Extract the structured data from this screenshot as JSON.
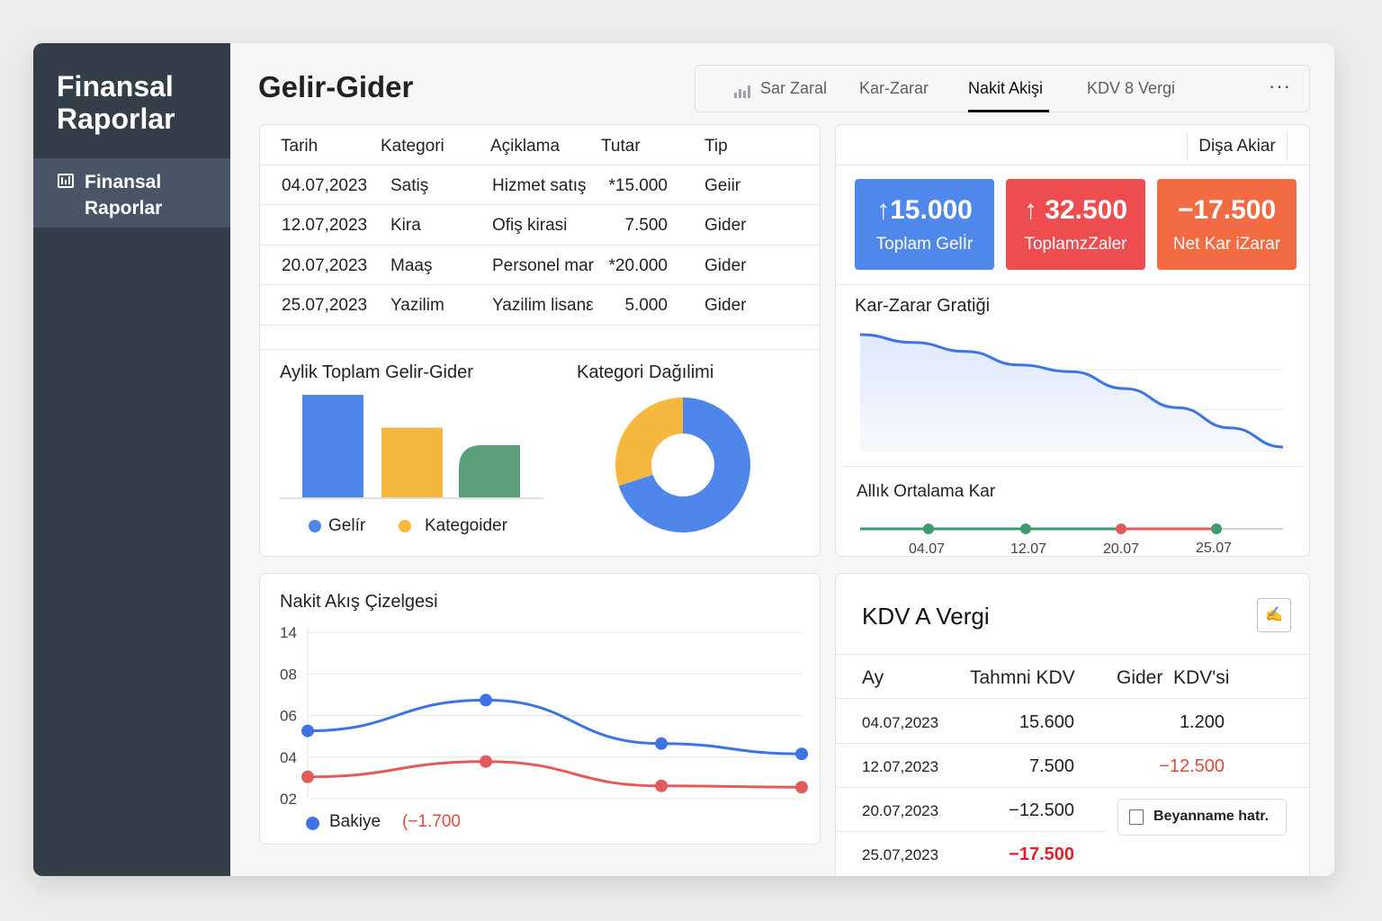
{
  "sidebar": {
    "brand_line1": "Finansal",
    "brand_line2": "Raporlar",
    "items": [
      {
        "label_line1": "Finansal",
        "label_line2": "Raporlar",
        "icon": "bar-chart-icon"
      }
    ]
  },
  "header": {
    "title": "Gelir-Gider",
    "tabs": [
      {
        "label": "Sar Zaral",
        "icon": "bar-chart-icon",
        "active": false
      },
      {
        "label": "Kar-Zarar",
        "active": false
      },
      {
        "label": "Nakit Akişi",
        "active": true
      },
      {
        "label": "KDV 8 Vergi",
        "active": false
      }
    ],
    "more": "···"
  },
  "transactions": {
    "headers": [
      "Tarih",
      "Kategori",
      "Açiklama",
      "Tutar",
      "Tip"
    ],
    "rows": [
      {
        "date": "04.07,2023",
        "category": "Satiş",
        "description": "Hizmet satış",
        "amount": "*15.000",
        "type": "Geiir"
      },
      {
        "date": "12.07,2023",
        "category": "Kira",
        "description": "Ofiş kirasi",
        "amount": "7.500",
        "type": "Gider"
      },
      {
        "date": "20.07,2023",
        "category": "Maaş",
        "description": "Personel mar",
        "amount": "*20.000",
        "type": "Gider"
      },
      {
        "date": "25.07,2023",
        "category": "Yazilim",
        "description": "Yazilim lisanε",
        "amount": "5.000",
        "type": "Gider"
      }
    ]
  },
  "monthly_chart": {
    "title": "Aylik Toplam Gelir-Gider",
    "legend": [
      {
        "label": "Gelír",
        "color": "#4f86ea"
      },
      {
        "label": "Kategoider",
        "color": "#f5b73d"
      }
    ]
  },
  "category_chart": {
    "title": "Kategori Dağılimi"
  },
  "export_button": "Dişa Akiar",
  "kpis": [
    {
      "value": "↑15.000",
      "label": "Toplam Gelİr",
      "color": "#4e88eb"
    },
    {
      "value": "↑ 32.500",
      "label": "ToplamzZaler",
      "color": "#ed4d4f"
    },
    {
      "value": "−17.500",
      "label": "Net Kar iZarar",
      "color": "#f36b42"
    }
  ],
  "profit_chart": {
    "title": "Kar-Zarar Gratiği"
  },
  "avg_chart": {
    "title": "Allık Ortalama Kar",
    "dates": [
      "04.07",
      "12.07",
      "20.07",
      "25.07"
    ]
  },
  "cashflow": {
    "title": "Nakit Akış Çizelgesi",
    "legend_label": "Bakiye",
    "legend_value": "(−1.700",
    "colors": {
      "balance": "#3d74e3",
      "expense": "#e25a5a"
    }
  },
  "kdv": {
    "title": "KDV A Vergi",
    "icon": "signature-icon",
    "headers": [
      "Ay",
      "Tahmni KDV",
      "Gider  KDV'si"
    ],
    "rows": [
      {
        "date": "04.07,2023",
        "estimated": "15.600",
        "expense": "1.200",
        "estimated_neg": false,
        "expense_neg": false
      },
      {
        "date": "12.07,2023",
        "estimated": "7.500",
        "expense": "−12.500",
        "estimated_neg": false,
        "expense_neg": true
      },
      {
        "date": "20.07,2023",
        "estimated": "−12.500",
        "expense": "",
        "estimated_neg": false,
        "expense_neg": false
      },
      {
        "date": "25.07,2023",
        "estimated": "−17.500",
        "expense": "",
        "estimated_neg": true,
        "expense_neg": false
      }
    ],
    "declaration_button": "Beyanname hatr."
  },
  "chart_data": [
    {
      "type": "bar",
      "title": "Aylik Toplam Gelir-Gider",
      "categories": [
        "",
        "",
        ""
      ],
      "values": [
        100,
        68,
        51
      ],
      "colors": [
        "#4f86ea",
        "#f5b73d",
        "#5a9e7a"
      ],
      "ylim": [
        0,
        100
      ]
    },
    {
      "type": "pie",
      "title": "Kategori Dağılimi",
      "labels": [
        "",
        ""
      ],
      "values": [
        70,
        30
      ],
      "colors": [
        "#4f86ea",
        "#f5b73d"
      ]
    },
    {
      "type": "area",
      "title": "Kar-Zarar Gratiği",
      "values": [
        100,
        93,
        85,
        73,
        67,
        52,
        35,
        17,
        0
      ],
      "color": "#3d74e3"
    },
    {
      "type": "line",
      "title": "Allık Ortalama Kar",
      "x": [
        "04.07",
        "12.07",
        "20.07",
        "25.07"
      ],
      "point_colors": [
        "#3f9a6e",
        "#3f9a6e",
        "#e25a5a",
        "#3f9a6e"
      ]
    },
    {
      "type": "line",
      "title": "Nakit Akış Çizelgesi",
      "yticks": [
        "14",
        "08",
        "06",
        "04",
        "02"
      ],
      "series": [
        {
          "name": "Bakiye",
          "values": [
            6.3,
            8.7,
            5.3,
            4.5
          ]
        },
        {
          "values": [
            2.7,
            3.9,
            2.0,
            1.9
          ]
        }
      ],
      "ylim": [
        1,
        14
      ]
    }
  ]
}
